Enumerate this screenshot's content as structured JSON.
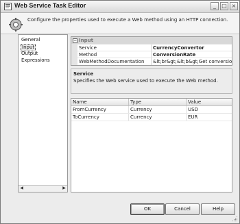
{
  "window": {
    "title": "Web Service Task Editor",
    "header_text": "Configure the properties used to execute a Web method using an HTTP connection."
  },
  "nav": {
    "items": [
      {
        "label": "General",
        "selected": false
      },
      {
        "label": "Input",
        "selected": true
      },
      {
        "label": "Output",
        "selected": false
      },
      {
        "label": "Expressions",
        "selected": false
      }
    ]
  },
  "properties": {
    "category": "Input",
    "rows": [
      {
        "name": "Service",
        "value": "CurrencyConvertor"
      },
      {
        "name": "Method",
        "value": "ConversionRate"
      },
      {
        "name": "WebMethodDocumentation",
        "value": "&lt;br&gt;&lt;b&gt;Get conversion rate fro"
      }
    ]
  },
  "description": {
    "title": "Service",
    "text": "Specifies the Web service used to execute the Web method."
  },
  "parameters": {
    "columns": [
      "Name",
      "Type",
      "Value"
    ],
    "rows": [
      {
        "name": "FromCurrency",
        "type": "Currency",
        "value": "USD"
      },
      {
        "name": "ToCurrency",
        "type": "Currency",
        "value": "EUR"
      }
    ]
  },
  "buttons": {
    "ok": "OK",
    "cancel": "Cancel",
    "help": "Help"
  },
  "controls": {
    "minimize": "_",
    "maximize": "□",
    "close": "×",
    "collapse": "−",
    "scroll_left": "◀",
    "scroll_right": "▶"
  }
}
